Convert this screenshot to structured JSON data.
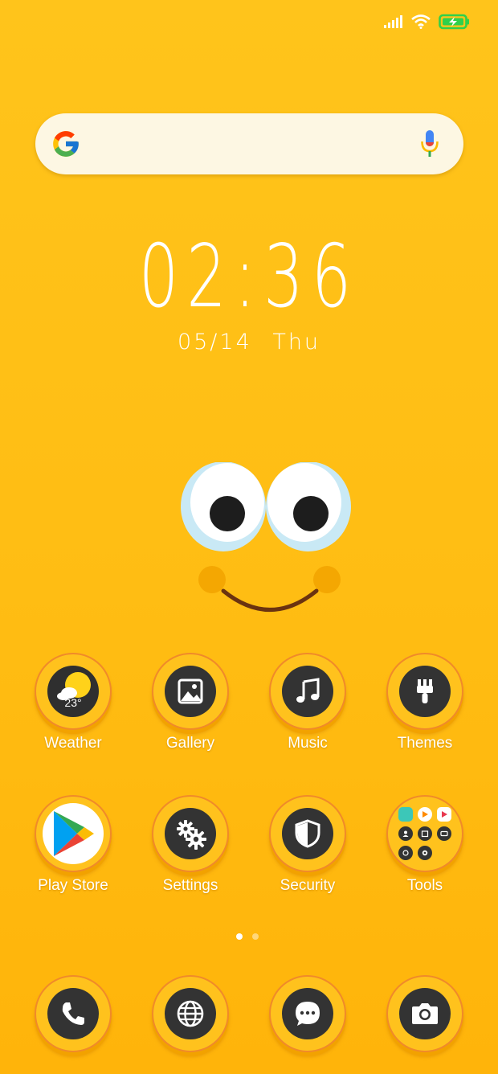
{
  "status_bar": {
    "signal_icon": "signal-icon",
    "wifi_icon": "wifi-icon",
    "battery_icon": "battery-charging-icon",
    "battery_color": "#30d04a"
  },
  "search": {
    "logo": "google-logo",
    "mic_icon": "mic-icon",
    "placeholder": ""
  },
  "clock": {
    "time": "02:36",
    "date": "05/14 Thu"
  },
  "apps_row1": [
    {
      "label": "Weather",
      "icon": "weather-icon",
      "temp": "23°"
    },
    {
      "label": "Gallery",
      "icon": "gallery-icon"
    },
    {
      "label": "Music",
      "icon": "music-note-icon"
    },
    {
      "label": "Themes",
      "icon": "paintbrush-icon"
    }
  ],
  "apps_row2": [
    {
      "label": "Play Store",
      "icon": "play-store-icon"
    },
    {
      "label": "Settings",
      "icon": "gears-icon"
    },
    {
      "label": "Security",
      "icon": "shield-icon"
    },
    {
      "label": "Tools",
      "icon": "tools-folder-icon"
    }
  ],
  "dock": [
    {
      "icon": "phone-icon"
    },
    {
      "icon": "browser-globe-icon"
    },
    {
      "icon": "messages-icon"
    },
    {
      "icon": "camera-icon"
    }
  ],
  "pager": {
    "pages": 2,
    "active": 1
  },
  "colors": {
    "wallpaper": "#ffbf15",
    "icon_bg": "#333333",
    "ring_border": "#f08a2a"
  }
}
